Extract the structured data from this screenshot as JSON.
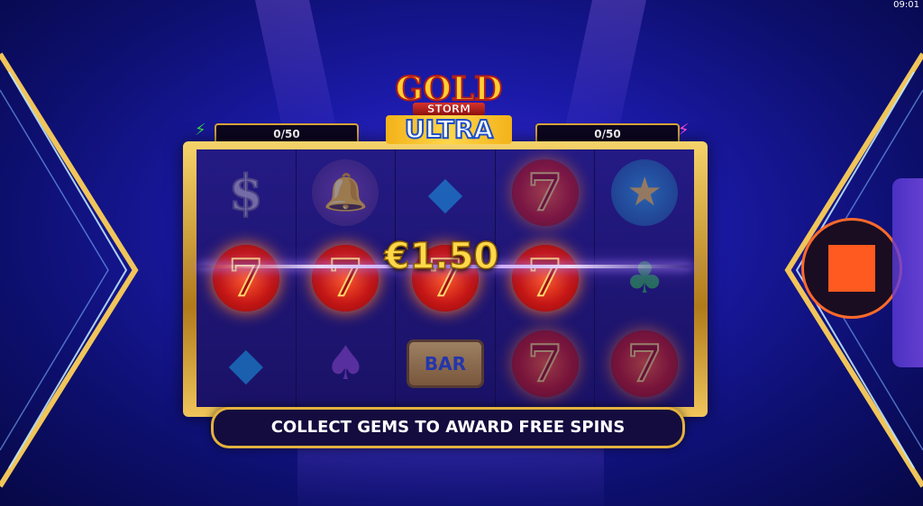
{
  "status_bar": {
    "time": "09:01"
  },
  "game": {
    "logo": {
      "line1": "GOLD",
      "line2": "STORM",
      "line3": "ULTRA"
    },
    "meters": {
      "left": {
        "value": "0/50",
        "icon": "green-bolt-icon"
      },
      "right": {
        "value": "0/50",
        "icon": "pink-bolt-icon"
      }
    },
    "win_amount": "€1.50",
    "banner": "COLLECT GEMS TO AWARD FREE SPINS",
    "stop_button": {
      "icon": "stop-square-icon",
      "color": "#ff5a1f"
    },
    "reels": [
      [
        "dollar",
        "seven",
        "gem-blue"
      ],
      [
        "bell",
        "seven",
        "spade"
      ],
      [
        "gem-blue",
        "seven",
        "bar"
      ],
      [
        "seven",
        "seven",
        "seven"
      ],
      [
        "star",
        "club",
        "seven"
      ]
    ]
  },
  "colors": {
    "accent_gold": "#e3b23e",
    "background": "#1b1aa8",
    "win_text": "#ffd84a"
  }
}
